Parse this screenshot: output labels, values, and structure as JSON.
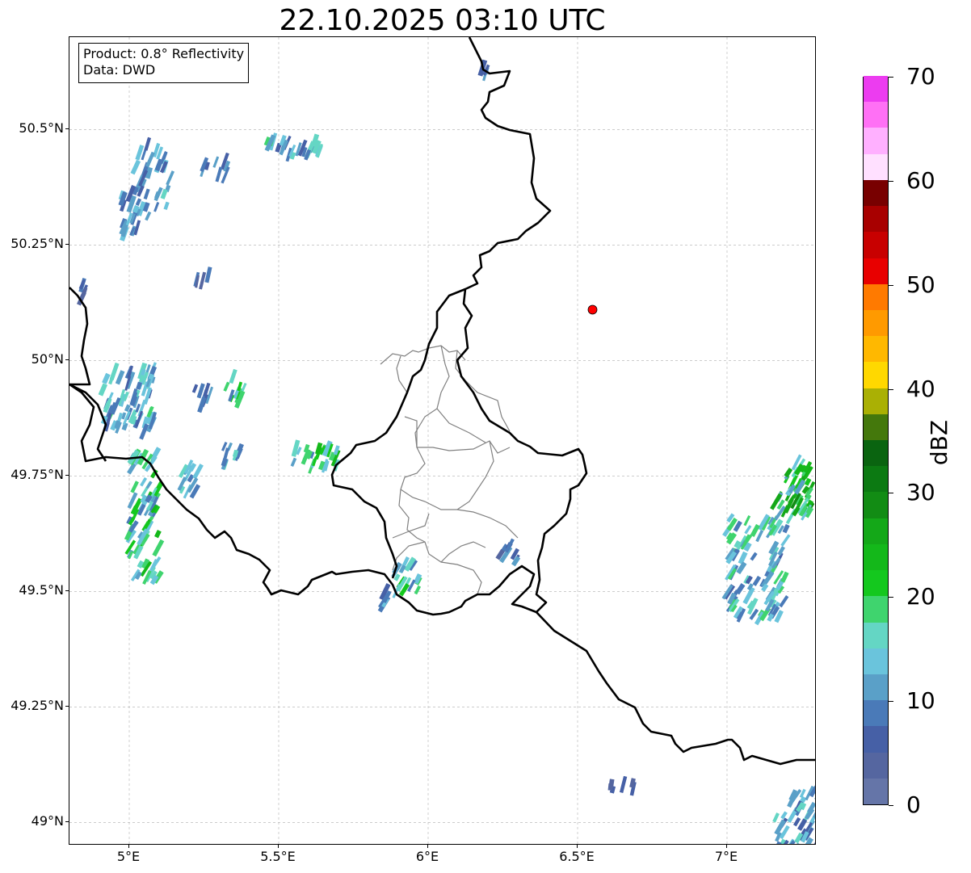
{
  "title": "22.10.2025 03:10 UTC",
  "info_box": {
    "product": "Product: 0.8° Reflectivity",
    "data": "Data: DWD"
  },
  "map": {
    "lon_range": [
      4.8,
      7.3
    ],
    "lat_range": [
      48.95,
      50.7
    ],
    "lat_ticks": [
      {
        "value": 50.5,
        "label": "50.5°N"
      },
      {
        "value": 50.25,
        "label": "50.25°N"
      },
      {
        "value": 50.0,
        "label": "50°N"
      },
      {
        "value": 49.75,
        "label": "49.75°N"
      },
      {
        "value": 49.5,
        "label": "49.5°N"
      },
      {
        "value": 49.25,
        "label": "49.25°N"
      },
      {
        "value": 49.0,
        "label": "49°N"
      }
    ],
    "lon_ticks": [
      {
        "value": 5.0,
        "label": "5°E"
      },
      {
        "value": 5.5,
        "label": "5.5°E"
      },
      {
        "value": 6.0,
        "label": "6°E"
      },
      {
        "value": 6.5,
        "label": "6.5°E"
      },
      {
        "value": 7.0,
        "label": "7°E"
      }
    ],
    "gridlines": true,
    "radar_site": {
      "lon": 6.55,
      "lat": 50.11,
      "color": "#ff0000"
    },
    "border_color": "#000000",
    "admin_color": "#808080"
  },
  "echo_clusters": [
    {
      "lon": 5.08,
      "lat": 50.39,
      "spread_lon": 0.06,
      "spread_lat": 0.08,
      "count": 30,
      "peak_dbz": 16,
      "angle": -70
    },
    {
      "lon": 5.0,
      "lat": 50.32,
      "spread_lon": 0.04,
      "spread_lat": 0.05,
      "count": 20,
      "peak_dbz": 15,
      "angle": -70
    },
    {
      "lon": 5.55,
      "lat": 50.46,
      "spread_lon": 0.09,
      "spread_lat": 0.02,
      "count": 22,
      "peak_dbz": 20,
      "angle": -70
    },
    {
      "lon": 5.28,
      "lat": 50.42,
      "spread_lon": 0.05,
      "spread_lat": 0.02,
      "count": 8,
      "peak_dbz": 12,
      "angle": -70
    },
    {
      "lon": 5.0,
      "lat": 49.91,
      "spread_lon": 0.09,
      "spread_lat": 0.07,
      "count": 70,
      "peak_dbz": 18,
      "angle": -70
    },
    {
      "lon": 5.05,
      "lat": 49.66,
      "spread_lon": 0.05,
      "spread_lat": 0.14,
      "count": 70,
      "peak_dbz": 24,
      "angle": -60
    },
    {
      "lon": 5.2,
      "lat": 49.74,
      "spread_lon": 0.03,
      "spread_lat": 0.03,
      "count": 12,
      "peak_dbz": 16,
      "angle": -60
    },
    {
      "lon": 5.35,
      "lat": 49.94,
      "spread_lon": 0.03,
      "spread_lat": 0.03,
      "count": 10,
      "peak_dbz": 22,
      "angle": -70
    },
    {
      "lon": 5.25,
      "lat": 49.92,
      "spread_lon": 0.03,
      "spread_lat": 0.02,
      "count": 8,
      "peak_dbz": 12,
      "angle": -70
    },
    {
      "lon": 5.34,
      "lat": 49.79,
      "spread_lon": 0.03,
      "spread_lat": 0.03,
      "count": 10,
      "peak_dbz": 18,
      "angle": -70
    },
    {
      "lon": 5.62,
      "lat": 49.79,
      "spread_lon": 0.08,
      "spread_lat": 0.02,
      "count": 24,
      "peak_dbz": 24,
      "angle": -70
    },
    {
      "lon": 5.93,
      "lat": 49.53,
      "spread_lon": 0.04,
      "spread_lat": 0.03,
      "count": 16,
      "peak_dbz": 22,
      "angle": -60
    },
    {
      "lon": 5.85,
      "lat": 49.49,
      "spread_lon": 0.02,
      "spread_lat": 0.02,
      "count": 6,
      "peak_dbz": 20,
      "angle": -60
    },
    {
      "lon": 6.27,
      "lat": 49.58,
      "spread_lon": 0.03,
      "spread_lat": 0.02,
      "count": 8,
      "peak_dbz": 12,
      "angle": -60
    },
    {
      "lon": 7.1,
      "lat": 49.55,
      "spread_lon": 0.1,
      "spread_lat": 0.11,
      "count": 90,
      "peak_dbz": 20,
      "angle": -60
    },
    {
      "lon": 7.22,
      "lat": 49.72,
      "spread_lon": 0.06,
      "spread_lat": 0.06,
      "count": 50,
      "peak_dbz": 28,
      "angle": -60
    },
    {
      "lon": 7.25,
      "lat": 49.0,
      "spread_lon": 0.09,
      "spread_lat": 0.07,
      "count": 50,
      "peak_dbz": 16,
      "angle": -60
    },
    {
      "lon": 6.65,
      "lat": 49.08,
      "spread_lon": 0.04,
      "spread_lat": 0.01,
      "count": 6,
      "peak_dbz": 10,
      "angle": -80
    },
    {
      "lon": 6.19,
      "lat": 50.62,
      "spread_lon": 0.01,
      "spread_lat": 0.02,
      "count": 4,
      "peak_dbz": 12,
      "angle": -70
    },
    {
      "lon": 4.84,
      "lat": 50.15,
      "spread_lon": 0.02,
      "spread_lat": 0.02,
      "count": 5,
      "peak_dbz": 10,
      "angle": -70
    },
    {
      "lon": 5.24,
      "lat": 50.18,
      "spread_lon": 0.03,
      "spread_lat": 0.01,
      "count": 4,
      "peak_dbz": 10,
      "angle": -80
    }
  ],
  "colorbar": {
    "label": "dBZ",
    "min": 0,
    "max": 70,
    "ticks": [
      "0",
      "10",
      "20",
      "30",
      "40",
      "50",
      "60",
      "70"
    ],
    "colors": [
      "#6575a8",
      "#5566a0",
      "#4660a6",
      "#4a7ab8",
      "#5aa0c8",
      "#6ac4dc",
      "#64d6c4",
      "#3fd46e",
      "#14c81e",
      "#14b81a",
      "#14a818",
      "#128c14",
      "#0c7a12",
      "#0a6410",
      "#44780c",
      "#aab004",
      "#ffd800",
      "#ffb800",
      "#ff9a00",
      "#ff7a00",
      "#e80000",
      "#c80000",
      "#a80000",
      "#780000",
      "#ffe0ff",
      "#ffb0ff",
      "#ff70f5",
      "#ec3cf0"
    ]
  }
}
